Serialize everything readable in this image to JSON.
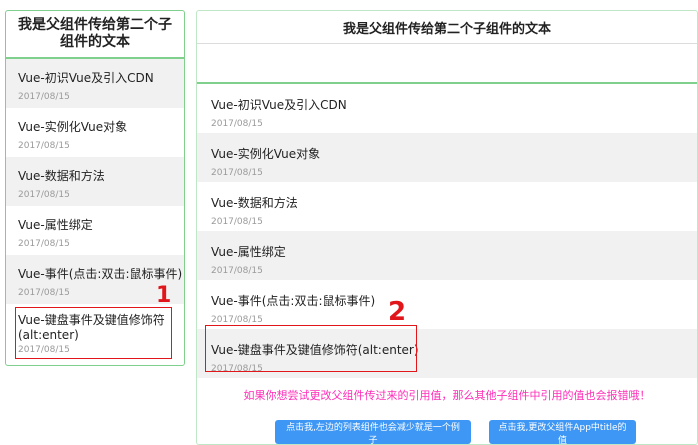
{
  "left": {
    "title": "我是父组件传给第二个子组件的文本",
    "items": [
      {
        "title": "Vue-初识Vue及引入CDN",
        "date": "2017/08/15"
      },
      {
        "title": "Vue-实例化Vue对象",
        "date": "2017/08/15"
      },
      {
        "title": "Vue-数据和方法",
        "date": "2017/08/15"
      },
      {
        "title": "Vue-属性绑定",
        "date": "2017/08/15"
      },
      {
        "title": "Vue-事件(点击:双击:鼠标事件)",
        "date": "2017/08/15"
      },
      {
        "title": "Vue-键盘事件及键值修饰符(alt:enter)",
        "date": "2017/08/15"
      }
    ]
  },
  "right": {
    "title": "我是父组件传给第二个子组件的文本",
    "items": [
      {
        "title": "Vue-初识Vue及引入CDN",
        "date": "2017/08/15"
      },
      {
        "title": "Vue-实例化Vue对象",
        "date": "2017/08/15"
      },
      {
        "title": "Vue-数据和方法",
        "date": "2017/08/15"
      },
      {
        "title": "Vue-属性绑定",
        "date": "2017/08/15"
      },
      {
        "title": "Vue-事件(点击:双击:鼠标事件)",
        "date": "2017/08/15"
      },
      {
        "title": "Vue-键盘事件及键值修饰符(alt:enter)",
        "date": "2017/08/15"
      }
    ],
    "warning": "如果你想尝试更改父组件传过来的引用值，那么其他子组件中引用的值也会报错哦！",
    "buttons": {
      "reduce_list": "点击我,左边的列表组件也会减少就是一个例子",
      "change_title": "点击我,更改父组件App中title的值"
    }
  },
  "annotations": {
    "one": "1",
    "two": "2"
  },
  "colors": {
    "panel_border": "#7fd08c",
    "warning": "#ff2db8",
    "button": "#3f97f5",
    "annotation": "#e0161b"
  }
}
